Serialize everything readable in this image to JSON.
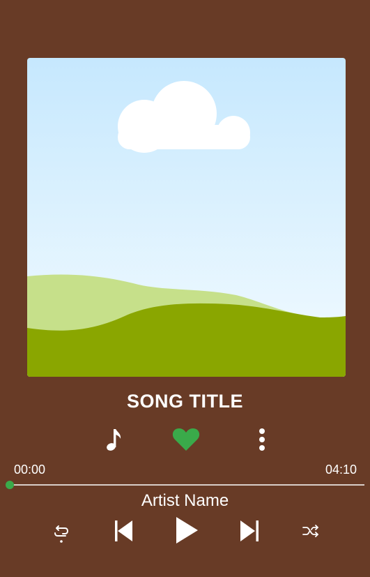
{
  "song": {
    "title": "SONG TITLE",
    "artist": "Artist Name"
  },
  "playback": {
    "current_time": "00:00",
    "total_time": "04:10",
    "progress": 0.0
  },
  "icons": {
    "lyrics": "music-note-icon",
    "like": "heart-icon",
    "more": "more-vertical-icon",
    "repeat": "repeat-icon",
    "previous": "skip-previous-icon",
    "play": "play-icon",
    "next": "skip-next-icon",
    "shuffle": "shuffle-icon"
  },
  "colors": {
    "background": "#683b26",
    "accent": "#3aaa4a",
    "sky_top": "#c6e8fe",
    "sky_bottom": "#f1fbff",
    "hill_light": "#c6e08a",
    "hill_dark": "#8aa600"
  }
}
